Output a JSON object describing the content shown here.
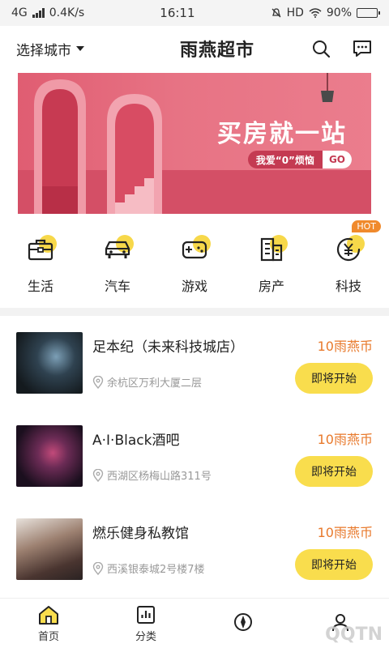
{
  "status_bar": {
    "network": "4G",
    "speed": "0.4K/s",
    "time": "16:11",
    "hd": "HD",
    "battery": "90%",
    "battery_level": 0.9
  },
  "header": {
    "city_label": "选择城市",
    "title": "雨燕超市"
  },
  "banner": {
    "title": "买房就一站",
    "tagline": "我爱“0”烦恼",
    "go": "GO"
  },
  "categories": [
    {
      "label": "生活",
      "icon": "briefcase-icon"
    },
    {
      "label": "汽车",
      "icon": "car-icon"
    },
    {
      "label": "游戏",
      "icon": "gamepad-icon"
    },
    {
      "label": "房产",
      "icon": "building-icon"
    },
    {
      "label": "科技",
      "icon": "yen-coin-icon",
      "badge": "HOT"
    }
  ],
  "items": [
    {
      "name": "足本纪（未来科技城店）",
      "address": "余杭区万利大厦二层",
      "price": "10雨燕币",
      "action": "即将开始"
    },
    {
      "name": "A·Ⅰ·Black酒吧",
      "address": "西湖区杨梅山路311号",
      "price": "10雨燕币",
      "action": "即将开始"
    },
    {
      "name": "燃乐健身私教馆",
      "address": "西溪银泰城2号楼7楼",
      "price": "10雨燕币",
      "action": "即将开始"
    }
  ],
  "tabbar": [
    {
      "label": "首页",
      "icon": "home-icon"
    },
    {
      "label": "分类",
      "icon": "chart-icon"
    },
    {
      "label": "",
      "icon": "explore-icon"
    },
    {
      "label": "",
      "icon": "profile-icon"
    }
  ],
  "watermark": "QQTN",
  "colors": {
    "accent": "#f9dd4d",
    "price": "#e8792b",
    "banner": "#e05d72"
  }
}
